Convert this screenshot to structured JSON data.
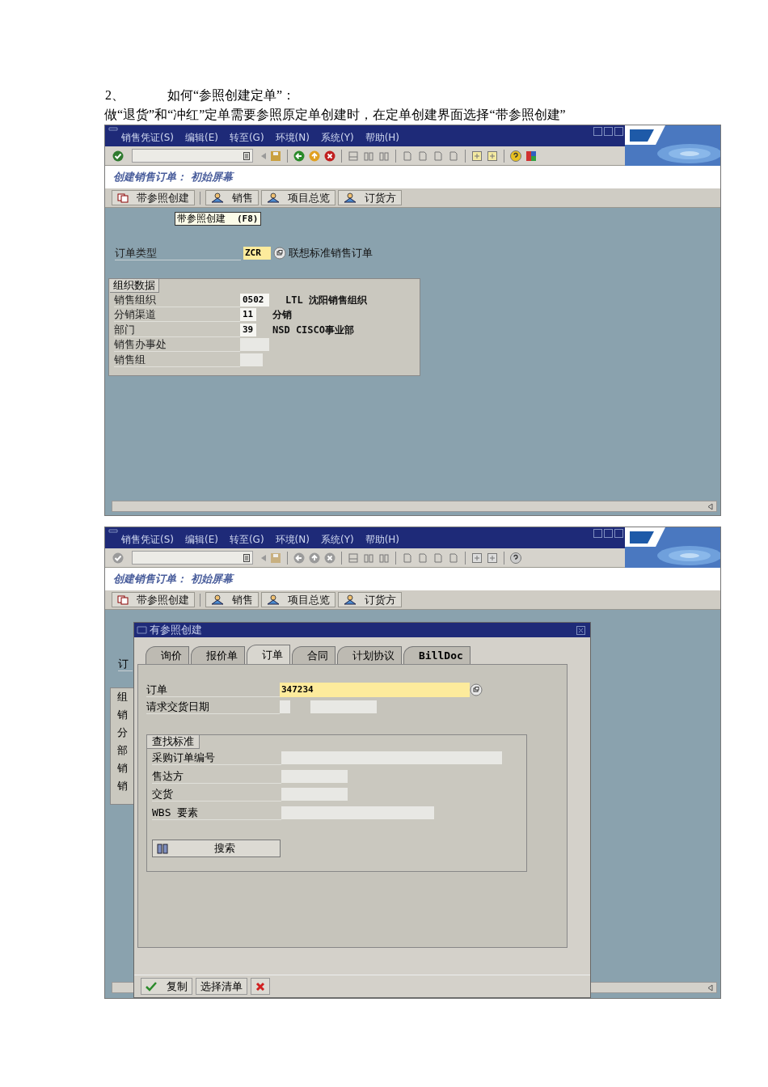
{
  "intro": {
    "number": "2、",
    "heading": "如何“参照创建定单”：",
    "paragraph": "做“退货”和“冲红”定单需要参照原定单创建时，在定单创建界面选择“带参照创建”"
  },
  "screen_1": {
    "menu": [
      "销售凭证(S)",
      "编辑(E)",
      "转至(G)",
      "环境(N)",
      "系统(Y)",
      "帮助(H)"
    ],
    "toolbar_enabled": true,
    "title": "创建销售订单： 初始屏幕",
    "app_buttons": [
      {
        "label": "带参照创建",
        "kind": "copy"
      },
      {
        "label": "销售",
        "kind": "person"
      },
      {
        "label": "项目总览",
        "kind": "person"
      },
      {
        "label": "订货方",
        "kind": "person"
      }
    ],
    "tooltip": {
      "label": "带参照创建",
      "shortcut": "(F8)"
    },
    "order_type": {
      "label": "订单类型",
      "value": "ZCR",
      "focused": true,
      "description": "联想标准销售订单"
    },
    "org_group": {
      "title": "组织数据",
      "rows": [
        {
          "label": "销售组织",
          "value": "0502",
          "description": "LTL 沈阳销售组织"
        },
        {
          "label": "分销渠道",
          "value": "11",
          "description": "分销"
        },
        {
          "label": "部门",
          "value": "39",
          "description": "NSD CISCO事业部"
        },
        {
          "label": "销售办事处"
        },
        {
          "label": "销售组"
        }
      ]
    }
  },
  "screen_2": {
    "menu": [
      "销售凭证(S)",
      "编辑(E)",
      "转至(G)",
      "环境(N)",
      "系统(Y)",
      "帮助(H)"
    ],
    "toolbar_enabled": false,
    "title": "创建销售订单： 初始屏幕",
    "app_buttons": [
      {
        "label": "带参照创建",
        "kind": "copy"
      },
      {
        "label": "销售",
        "kind": "person"
      },
      {
        "label": "项目总览",
        "kind": "person"
      },
      {
        "label": "订货方",
        "kind": "person"
      }
    ],
    "background_labels": [
      "订",
      "组",
      "销",
      "分",
      "部",
      "销",
      "销"
    ],
    "dialog": {
      "title": "有参照创建",
      "tabs": [
        {
          "label": "询价",
          "selected": false
        },
        {
          "label": "报价单",
          "selected": false
        },
        {
          "label": "订单",
          "selected": true
        },
        {
          "label": "合同",
          "selected": false
        },
        {
          "label": "计划协议",
          "selected": false
        },
        {
          "label": "BillDoc",
          "selected": false
        }
      ],
      "order": {
        "label": "订单",
        "value": "347234",
        "focused": true
      },
      "delivery_date": {
        "label": "请求交货日期"
      },
      "search_group": {
        "title": "查找标准",
        "fields": [
          {
            "label": "采购订单编号"
          },
          {
            "label": "售达方"
          },
          {
            "label": "交货"
          },
          {
            "label": "WBS 要素"
          }
        ],
        "button": "搜索"
      },
      "footer": [
        {
          "label": "复制",
          "kind": "confirm"
        },
        {
          "label": "选择清单",
          "kind": "text"
        },
        {
          "kind": "cancel"
        }
      ]
    }
  }
}
